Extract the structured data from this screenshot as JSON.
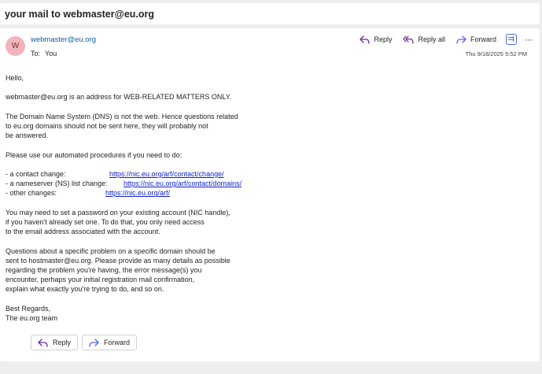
{
  "subject": "your mail to webmaster@eu.org",
  "message": {
    "avatar_initial": "W",
    "sender": "webmaster@eu.org",
    "to_label": "To:",
    "to_value": "You",
    "date": "Thu 9/18/2025 5:52 PM",
    "actions": {
      "reply": "Reply",
      "reply_all": "Reply all",
      "forward": "Forward",
      "more": "···"
    },
    "body": {
      "greeting": "Hello,",
      "p1": "webmaster@eu.org is an address for WEB-RELATED MATTERS ONLY.",
      "p2": [
        "The Domain Name System (DNS) is not the web. Hence questions related",
        "to eu.org domains should not be sent here, they will probably not",
        "be answered."
      ],
      "p3": "Please use our automated procedures if you need to do:",
      "links": [
        {
          "label": " - a contact change:",
          "url": "https://nic.eu.org/arf/contact/change/"
        },
        {
          "label": " - a nameserver (NS) list change:",
          "url": "https://nic.eu.org/arf/contact/domains/"
        },
        {
          "label": " - other changes:",
          "url": "https://nic.eu.org/arf/"
        }
      ],
      "p4": [
        "You may need to set a password on your existing account (NIC handle),",
        "if you haven't already set one. To do that, you only need access",
        "to the email address associated with the account."
      ],
      "p5": [
        "Questions about a specific problem on a specific domain should be",
        "sent to hostmaster@eu.org. Please provide as many details as possible",
        "regarding the problem you're having, the error message(s) you",
        "encounter, perhaps your initial registration mail confirmation,",
        "explain what exactly you're trying to do, and so on."
      ],
      "signoff": [
        "Best Regards,",
        "The eu.org team"
      ]
    },
    "bottom_buttons": {
      "reply": "Reply",
      "forward": "Forward"
    }
  },
  "colors": {
    "link": "#0b1fd1",
    "sender": "#115ea3",
    "reply_icon": "#6b2d8f",
    "forward_icon": "#4f6bed",
    "avatar_bg": "#f1b5bb"
  }
}
